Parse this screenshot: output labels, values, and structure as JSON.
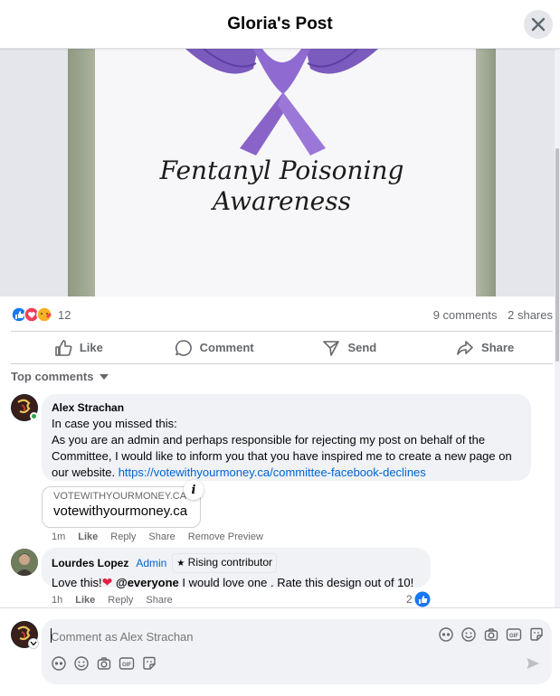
{
  "header": {
    "title": "Gloria's Post"
  },
  "post": {
    "image_text_line1": "Fentanyl Poisoning",
    "image_text_line2": "Awareness",
    "reaction_count": "12",
    "comments_count": "9 comments",
    "shares_count": "2 shares"
  },
  "actions": {
    "like": "Like",
    "comment": "Comment",
    "send": "Send",
    "share": "Share"
  },
  "sort_label": "Top comments",
  "comments": [
    {
      "author": "Alex Strachan",
      "text_line1": "In case you missed this:",
      "text_body": "As you are an admin and perhaps responsible for rejecting my post on behalf of the Committee, I would like to inform you that you have inspired me to create a new page on our website. ",
      "link": "https://votewithyourmoney.ca/committee-facebook-declines",
      "preview_domain": "VOTEWITHYOURMONEY.CA",
      "preview_title": "votewithyourmoney.ca",
      "time": "1m",
      "like": "Like",
      "reply": "Reply",
      "share": "Share",
      "remove_preview": "Remove Preview"
    },
    {
      "author": "Lourdes Lopez",
      "role": "Admin",
      "badge": "Rising contributor",
      "text_before": "Love this!",
      "mention": "@everyone",
      "text_after": " I would love one . Rate this design out of 10!",
      "time": "1h",
      "like": "Like",
      "reply": "Reply",
      "share": "Share",
      "reaction_count": "2"
    }
  ],
  "composer": {
    "placeholder": "Comment as Alex Strachan"
  },
  "colors": {
    "accent": "#0866ff",
    "link": "#0064d1",
    "ribbon": "#8a63c9",
    "heart": "#e41e3f"
  }
}
